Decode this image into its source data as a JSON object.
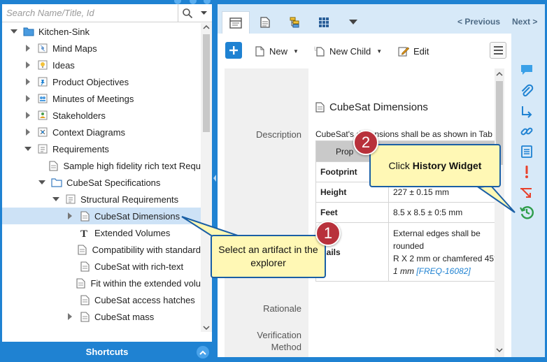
{
  "explorer": {
    "search_placeholder": "Search Name/Title, Id",
    "tree": [
      {
        "label": "Kitchen-Sink",
        "indent": 0,
        "twisty": "expanded",
        "icon": "folder-open-icon",
        "selected": false
      },
      {
        "label": "Mind Maps",
        "indent": 1,
        "twisty": "collapsed",
        "icon": "mind-map-icon",
        "selected": false
      },
      {
        "label": "Ideas",
        "indent": 1,
        "twisty": "collapsed",
        "icon": "idea-bulb-icon",
        "selected": false
      },
      {
        "label": "Product Objectives",
        "indent": 1,
        "twisty": "collapsed",
        "icon": "pin-icon",
        "selected": false
      },
      {
        "label": "Minutes of Meetings",
        "indent": 1,
        "twisty": "collapsed",
        "icon": "meeting-icon",
        "selected": false
      },
      {
        "label": "Stakeholders",
        "indent": 1,
        "twisty": "collapsed",
        "icon": "stakeholder-icon",
        "selected": false
      },
      {
        "label": "Context Diagrams",
        "indent": 1,
        "twisty": "collapsed",
        "icon": "diagram-icon",
        "selected": false
      },
      {
        "label": "Requirements",
        "indent": 1,
        "twisty": "expanded",
        "icon": "requirements-icon",
        "selected": false
      },
      {
        "label": "Sample high fidelity rich text Requ",
        "indent": 2,
        "twisty": "none",
        "icon": "document-icon",
        "selected": false
      },
      {
        "label": "CubeSat Specifications",
        "indent": 2,
        "twisty": "expanded",
        "icon": "folder-icon",
        "selected": false
      },
      {
        "label": "Structural Requirements",
        "indent": 3,
        "twisty": "expanded",
        "icon": "requirements-icon",
        "selected": false
      },
      {
        "label": "CubeSat Dimensions",
        "indent": 4,
        "twisty": "collapsed",
        "icon": "document-icon",
        "selected": true
      },
      {
        "label": "Extended Volumes",
        "indent": 4,
        "twisty": "none",
        "icon": "text-type-icon",
        "selected": false
      },
      {
        "label": "Compatibility with standard",
        "indent": 4,
        "twisty": "none",
        "icon": "document-icon",
        "selected": false
      },
      {
        "label": "CubeSat with rich-text",
        "indent": 4,
        "twisty": "none",
        "icon": "document-icon",
        "selected": false
      },
      {
        "label": "Fit within the extended volu",
        "indent": 4,
        "twisty": "none",
        "icon": "document-icon",
        "selected": false
      },
      {
        "label": "CubeSat access hatches",
        "indent": 4,
        "twisty": "none",
        "icon": "document-icon",
        "selected": false
      },
      {
        "label": "CubeSat mass",
        "indent": 4,
        "twisty": "collapsed",
        "icon": "document-icon",
        "selected": false
      }
    ],
    "shortcuts_label": "Shortcuts"
  },
  "tabs": [
    {
      "name": "overview-tab-icon"
    },
    {
      "name": "document-tab-icon"
    },
    {
      "name": "relations-tab-icon"
    },
    {
      "name": "grid-tab-icon"
    },
    {
      "name": "more-tabs-icon"
    }
  ],
  "nav": {
    "previous": "< Previous",
    "next": "Next >"
  },
  "toolbar": {
    "new_label": "New",
    "new_child_label": "New Child",
    "edit_label": "Edit"
  },
  "artifact": {
    "title": "CubeSat Dimensions",
    "description_label": "Description",
    "description_text": "CubeSat's dimensions shall be as shown in Tab",
    "table_header": "Prop",
    "rows": [
      {
        "name": "Footprint",
        "value": ""
      },
      {
        "name": "Height",
        "value": "227 ± 0.15 mm"
      },
      {
        "name": "Feet",
        "value": "8.5 x 8.5 ± 0:5 mm"
      }
    ],
    "rails_name": "Rails",
    "rails_value_line1": "External edges shall be",
    "rails_value_line2": "rounded",
    "rails_value_line3": "R X 2 mm or chamfered 45°",
    "rails_value_line4": "1 mm",
    "rails_ref": "[FREQ-16082]",
    "rationale_label": "Rationale",
    "verification_label": "Verification Method"
  },
  "widgets": [
    {
      "name": "comments-widget-icon",
      "color": "#3aa0e8"
    },
    {
      "name": "attachments-widget-icon",
      "color": "#1f82d2"
    },
    {
      "name": "trace-widget-icon",
      "color": "#1f82d2"
    },
    {
      "name": "links-widget-icon",
      "color": "#1f82d2"
    },
    {
      "name": "reviews-widget-icon",
      "color": "#1f82d2"
    },
    {
      "name": "suspect-widget-icon",
      "color": "#e8412c"
    },
    {
      "name": "impact-widget-icon",
      "color": "#e8412c"
    },
    {
      "name": "history-widget-icon",
      "color": "#2e9d4a"
    }
  ],
  "callouts": {
    "step1_number": "1",
    "step1_text": "Select an artifact in the explorer",
    "step2_number": "2",
    "step2_prefix": "Click ",
    "step2_bold": "History Widget"
  },
  "colors": {
    "brand_blue": "#1f82d2",
    "selection": "#cde2f6",
    "callout_fill": "#fff8b5",
    "callout_border": "#1a5fa5",
    "badge": "#b8313b"
  }
}
